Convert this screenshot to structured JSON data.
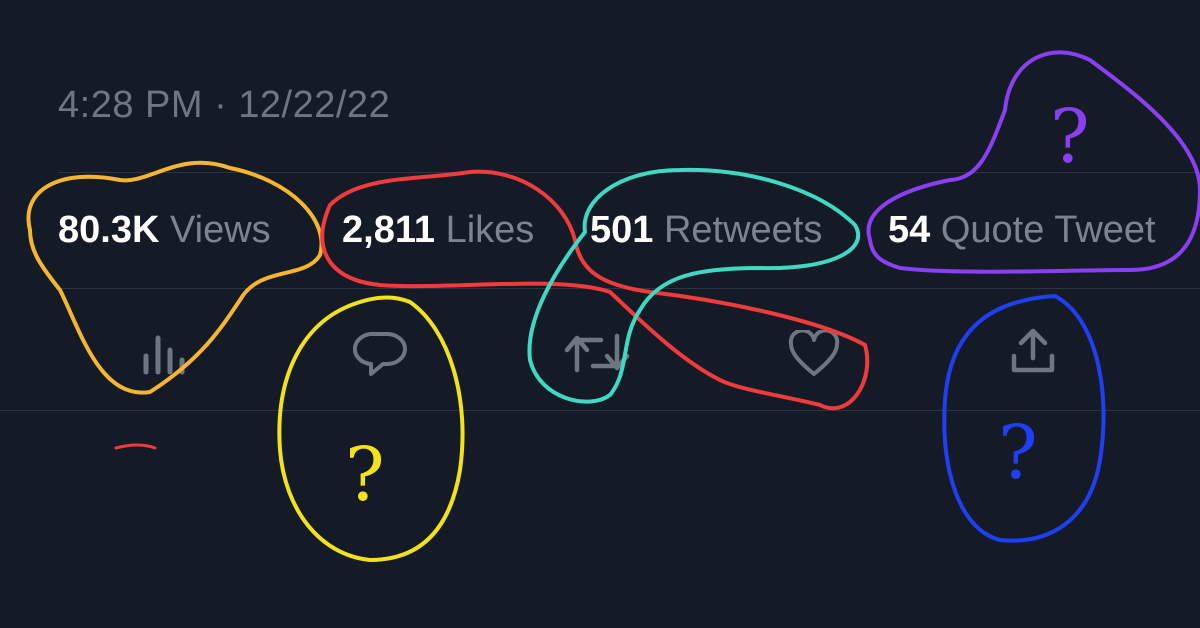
{
  "tweet": {
    "timestamp": "4:28 PM · 12/22/22"
  },
  "stats": {
    "views": {
      "count": "80.3K",
      "label": "Views"
    },
    "likes": {
      "count": "2,811",
      "label": "Likes"
    },
    "retweets": {
      "count": "501",
      "label": "Retweets"
    },
    "quotes": {
      "count": "54",
      "label": "Quote Tweet"
    }
  },
  "actions": [
    "analytics-icon",
    "reply-icon",
    "retweet-icon",
    "like-icon",
    "share-icon"
  ],
  "annotations": {
    "marks": [
      "?",
      "?",
      "?"
    ],
    "colors": {
      "orange": "#f5b531",
      "red": "#ef3b3b",
      "teal": "#3ed8c3",
      "purple": "#8a3ff2",
      "yellow": "#f2e21d",
      "blue": "#1f3ff2"
    }
  },
  "colors": {
    "background": "#151b26",
    "text_muted": "#7b8590",
    "text_strong": "#ffffff",
    "divider": "#2c3440"
  }
}
